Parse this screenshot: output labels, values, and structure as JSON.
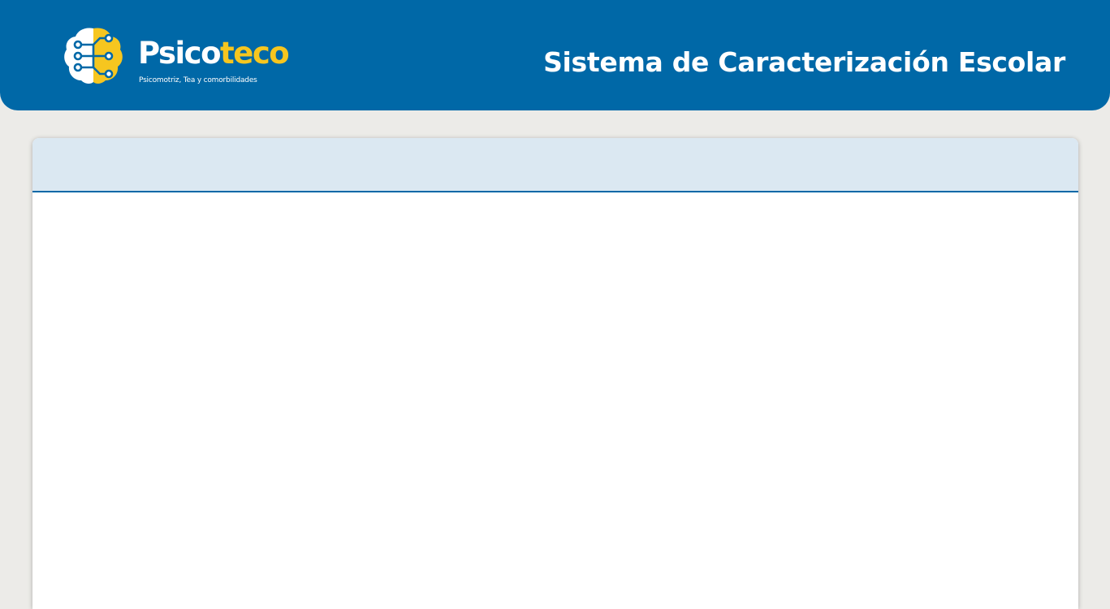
{
  "header": {
    "brand": {
      "name_part1": "Psico",
      "name_part2": "teco",
      "tagline": "Psicomotriz, Tea y comorbilidades",
      "logo_icon": "brain-circuit-icon"
    },
    "title": "Sistema de Caracterización Escolar"
  },
  "panel": {
    "header_text": "",
    "body_text": ""
  },
  "colors": {
    "primary": "#0068a7",
    "accent": "#f6c61f",
    "page_background": "#ecebe8",
    "panel_header": "#dbe8f2",
    "panel_body": "#ffffff"
  }
}
